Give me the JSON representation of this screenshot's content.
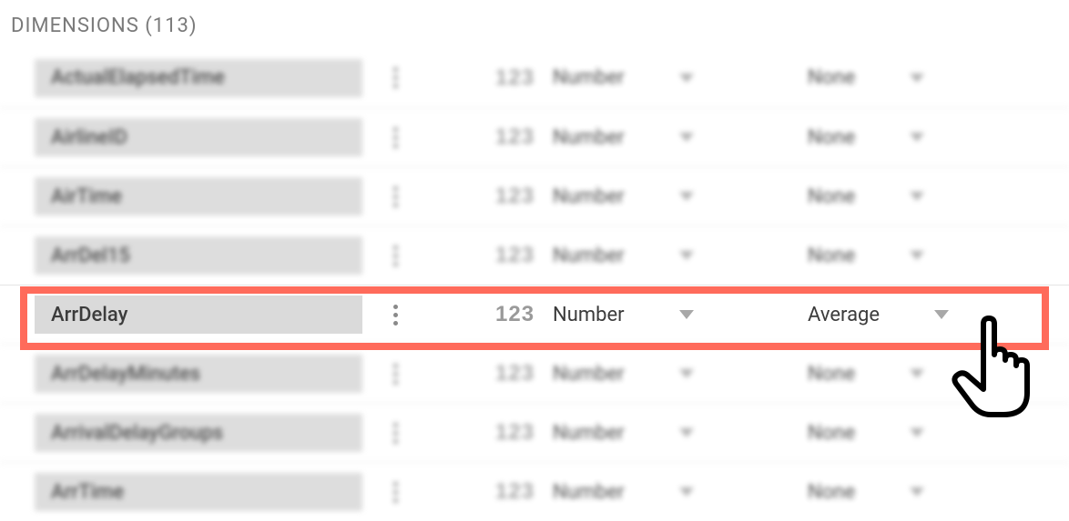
{
  "header": {
    "title": "DIMENSIONS",
    "count": 113
  },
  "type_icon_label": "123",
  "rows": [
    {
      "name": "ActualElapsedTime",
      "type": "Number",
      "agg": "None",
      "focused": false
    },
    {
      "name": "AirlineID",
      "type": "Number",
      "agg": "None",
      "focused": false
    },
    {
      "name": "AirTime",
      "type": "Number",
      "agg": "None",
      "focused": false
    },
    {
      "name": "ArrDel15",
      "type": "Number",
      "agg": "None",
      "focused": false
    },
    {
      "name": "ArrDelay",
      "type": "Number",
      "agg": "Average",
      "focused": true
    },
    {
      "name": "ArrDelayMinutes",
      "type": "Number",
      "agg": "None",
      "focused": false
    },
    {
      "name": "ArrivalDelayGroups",
      "type": "Number",
      "agg": "None",
      "focused": false
    },
    {
      "name": "ArrTime",
      "type": "Number",
      "agg": "None",
      "focused": false
    }
  ]
}
